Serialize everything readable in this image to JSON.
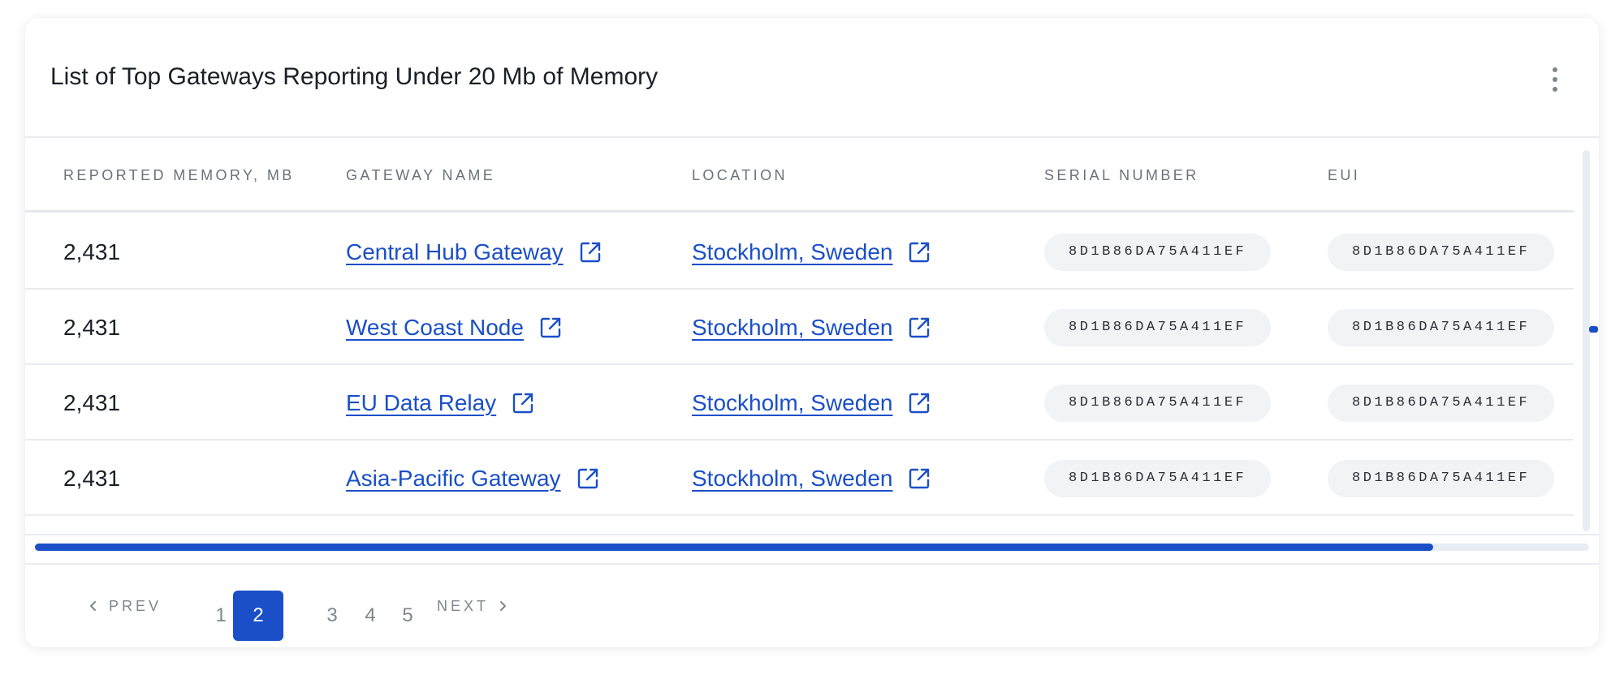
{
  "card": {
    "title": "List of Top Gateways Reporting Under 20 Mb of Memory"
  },
  "table": {
    "headers": [
      "REPORTED MEMORY, MB",
      "GATEWAY NAME",
      "LOCATION",
      "SERIAL NUMBER",
      "EUI"
    ],
    "rows": [
      {
        "memory": "2,431",
        "gateway": "Central Hub Gateway",
        "location": "Stockholm, Sweden",
        "serial": "8D1B86DA75A411EF",
        "eui": "8D1B86DA75A411EF"
      },
      {
        "memory": "2,431",
        "gateway": "West Coast Node",
        "location": "Stockholm, Sweden",
        "serial": "8D1B86DA75A411EF",
        "eui": "8D1B86DA75A411EF"
      },
      {
        "memory": "2,431",
        "gateway": "EU Data Relay",
        "location": "Stockholm, Sweden",
        "serial": "8D1B86DA75A411EF",
        "eui": "8D1B86DA75A411EF"
      },
      {
        "memory": "2,431",
        "gateway": "Asia-Pacific Gateway",
        "location": "Stockholm, Sweden",
        "serial": "8D1B86DA75A411EF",
        "eui": "8D1B86DA75A411EF"
      }
    ],
    "horizontal_scroll_fraction_visible": 0.9
  },
  "pagination": {
    "prev_label": "PREV",
    "next_label": "NEXT",
    "pages": [
      "1",
      "2",
      "3",
      "4",
      "5"
    ],
    "current_page": "2"
  },
  "icons": {
    "menu": "kebab-vertical-icon",
    "external_link": "external-link-icon",
    "prev": "chevron-left-icon",
    "next": "chevron-right-icon"
  },
  "colors": {
    "accent": "#1a4fc8",
    "chip_bg": "#f2f3f5",
    "muted_text": "#7f858e",
    "divider": "#e9ebef"
  }
}
